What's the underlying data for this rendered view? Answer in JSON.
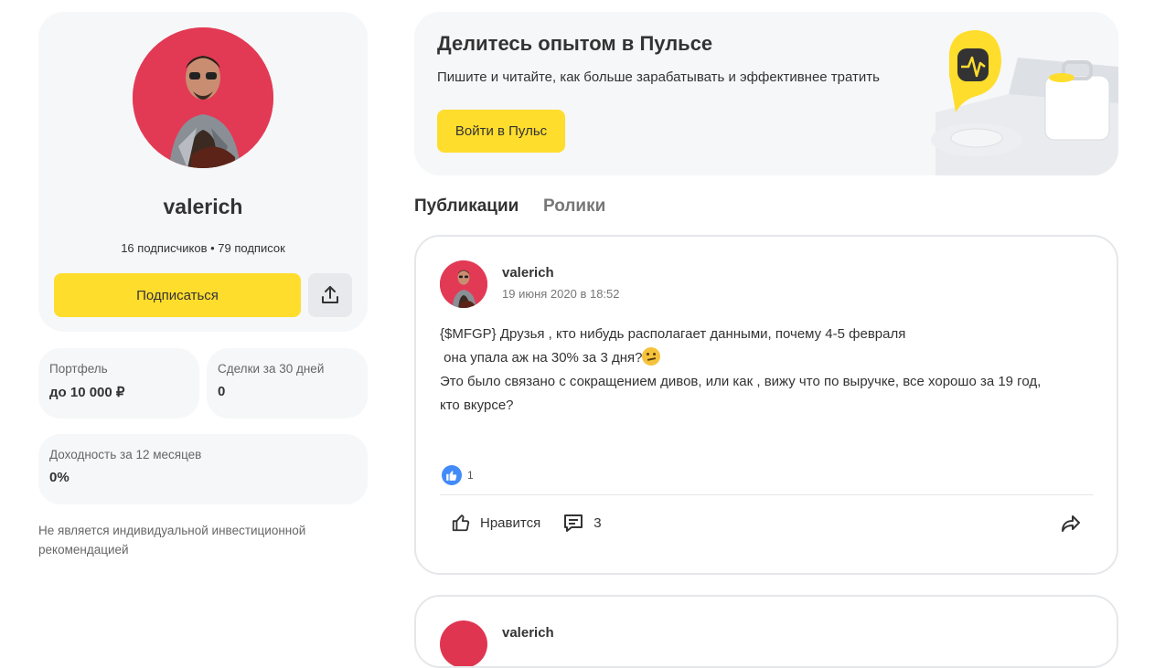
{
  "profile": {
    "username": "valerich",
    "followers_text": "16 подписчиков • 79 подписок",
    "subscribe_label": "Подписаться",
    "share_icon": "upload-icon"
  },
  "stats": {
    "portfolio_label": "Портфель",
    "portfolio_value": "до 10 000 ₽",
    "deals_label": "Сделки за 30 дней",
    "deals_value": "0",
    "yield_label": "Доходность за 12 месяцев",
    "yield_value": "0%"
  },
  "disclaimer": "Не является индивидуальной инвестиционной рекомендацией",
  "banner": {
    "title": "Делитесь опытом в Пульсе",
    "text": "Пишите и читайте, как больше зарабатывать и эффективнее тратить",
    "button_label": "Войти в Пульс"
  },
  "tabs": [
    {
      "label": "Публикации",
      "active": true
    },
    {
      "label": "Ролики",
      "active": false
    }
  ],
  "post": {
    "author": "valerich",
    "date": "19 июня 2020 в 18:52",
    "lines": [
      "{$MFGP} Друзья , кто нибудь располагает данными, почему 4-5 февраля",
      " она упала аж на 30% за 3 дня?",
      "Это было связано с сокращением дивов, или как , вижу что по выручке, все хорошо за 19 год,",
      "кто вкурсе?"
    ],
    "reaction_count": "1",
    "like_label": "Нравится",
    "comments_count": "3"
  },
  "post2": {
    "author": "valerich"
  },
  "colors": {
    "accent": "#ffdd2d",
    "card_bg": "#f6f7f8",
    "like_blue": "#428bf9"
  }
}
